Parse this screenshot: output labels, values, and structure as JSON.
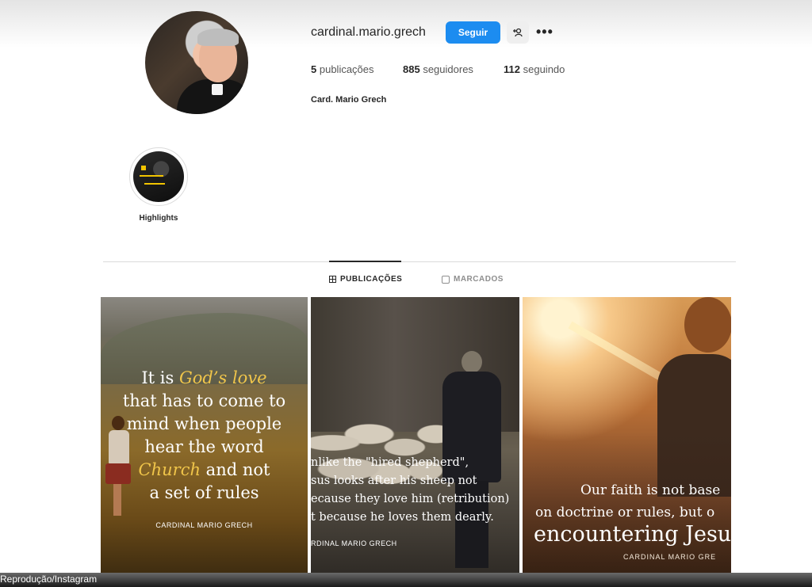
{
  "profile": {
    "username": "cardinal.mario.grech",
    "follow_label": "Seguir",
    "add_friend_icon": "add-person-icon",
    "more_label": "•••",
    "stats": {
      "posts_count": "5",
      "posts_label": "publicações",
      "followers_count": "885",
      "followers_label": "seguidores",
      "following_count": "112",
      "following_label": "seguindo"
    },
    "full_name": "Card. Mario Grech"
  },
  "highlights": [
    {
      "label": "Highlights"
    }
  ],
  "tabs": {
    "posts_label": "PUBLICAÇÕES",
    "tagged_label": "MARCADOS"
  },
  "posts": [
    {
      "line1_a": "It is ",
      "line1_hl": "God’s love",
      "line2": "that has to come to",
      "line3": "mind when people",
      "line4": "hear the word",
      "line5_hl": "Church",
      "line5_b": " and not",
      "line6": "a set of rules",
      "signature": "CARDINAL MARIO GRECH"
    },
    {
      "line1": "nlike the \"hired shepherd\",",
      "line2": "sus looks after his sheep not",
      "line3": "ecause they love him (retribution)",
      "line4": "t because he loves them dearly.",
      "signature": "RDINAL MARIO GRECH"
    },
    {
      "line1": "Our faith is not base",
      "line2": "on doctrine or rules, but o",
      "line3": "encountering Jesu",
      "signature": "CARDINAL MARIO GRE"
    }
  ],
  "credit": "Reprodução/Instagram",
  "colors": {
    "follow_button": "#1c8cf0",
    "highlight_text": "#f0c54a"
  }
}
